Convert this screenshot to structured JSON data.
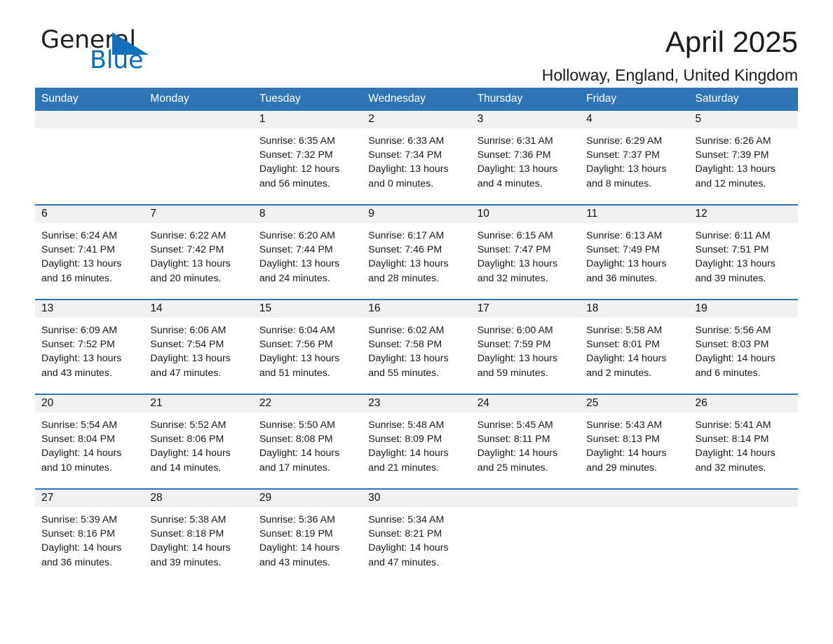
{
  "brand": {
    "line1": "General",
    "line2": "Blue",
    "flag_icon": "triangle-flag-icon",
    "accent_color": "#1170b8"
  },
  "header": {
    "title": "April 2025",
    "subtitle": "Holloway, England, United Kingdom"
  },
  "theme": {
    "header_bg": "#2e75b6",
    "daynum_bg": "#f1f1f1",
    "row_divider": "#2e75b6"
  },
  "weekday_headers": [
    "Sunday",
    "Monday",
    "Tuesday",
    "Wednesday",
    "Thursday",
    "Friday",
    "Saturday"
  ],
  "weeks": [
    [
      {
        "day": "",
        "sunrise": "",
        "sunset": "",
        "daylight_1": "",
        "daylight_2": ""
      },
      {
        "day": "",
        "sunrise": "",
        "sunset": "",
        "daylight_1": "",
        "daylight_2": ""
      },
      {
        "day": "1",
        "sunrise": "Sunrise: 6:35 AM",
        "sunset": "Sunset: 7:32 PM",
        "daylight_1": "Daylight: 12 hours",
        "daylight_2": "and 56 minutes."
      },
      {
        "day": "2",
        "sunrise": "Sunrise: 6:33 AM",
        "sunset": "Sunset: 7:34 PM",
        "daylight_1": "Daylight: 13 hours",
        "daylight_2": "and 0 minutes."
      },
      {
        "day": "3",
        "sunrise": "Sunrise: 6:31 AM",
        "sunset": "Sunset: 7:36 PM",
        "daylight_1": "Daylight: 13 hours",
        "daylight_2": "and 4 minutes."
      },
      {
        "day": "4",
        "sunrise": "Sunrise: 6:29 AM",
        "sunset": "Sunset: 7:37 PM",
        "daylight_1": "Daylight: 13 hours",
        "daylight_2": "and 8 minutes."
      },
      {
        "day": "5",
        "sunrise": "Sunrise: 6:26 AM",
        "sunset": "Sunset: 7:39 PM",
        "daylight_1": "Daylight: 13 hours",
        "daylight_2": "and 12 minutes."
      }
    ],
    [
      {
        "day": "6",
        "sunrise": "Sunrise: 6:24 AM",
        "sunset": "Sunset: 7:41 PM",
        "daylight_1": "Daylight: 13 hours",
        "daylight_2": "and 16 minutes."
      },
      {
        "day": "7",
        "sunrise": "Sunrise: 6:22 AM",
        "sunset": "Sunset: 7:42 PM",
        "daylight_1": "Daylight: 13 hours",
        "daylight_2": "and 20 minutes."
      },
      {
        "day": "8",
        "sunrise": "Sunrise: 6:20 AM",
        "sunset": "Sunset: 7:44 PM",
        "daylight_1": "Daylight: 13 hours",
        "daylight_2": "and 24 minutes."
      },
      {
        "day": "9",
        "sunrise": "Sunrise: 6:17 AM",
        "sunset": "Sunset: 7:46 PM",
        "daylight_1": "Daylight: 13 hours",
        "daylight_2": "and 28 minutes."
      },
      {
        "day": "10",
        "sunrise": "Sunrise: 6:15 AM",
        "sunset": "Sunset: 7:47 PM",
        "daylight_1": "Daylight: 13 hours",
        "daylight_2": "and 32 minutes."
      },
      {
        "day": "11",
        "sunrise": "Sunrise: 6:13 AM",
        "sunset": "Sunset: 7:49 PM",
        "daylight_1": "Daylight: 13 hours",
        "daylight_2": "and 36 minutes."
      },
      {
        "day": "12",
        "sunrise": "Sunrise: 6:11 AM",
        "sunset": "Sunset: 7:51 PM",
        "daylight_1": "Daylight: 13 hours",
        "daylight_2": "and 39 minutes."
      }
    ],
    [
      {
        "day": "13",
        "sunrise": "Sunrise: 6:09 AM",
        "sunset": "Sunset: 7:52 PM",
        "daylight_1": "Daylight: 13 hours",
        "daylight_2": "and 43 minutes."
      },
      {
        "day": "14",
        "sunrise": "Sunrise: 6:06 AM",
        "sunset": "Sunset: 7:54 PM",
        "daylight_1": "Daylight: 13 hours",
        "daylight_2": "and 47 minutes."
      },
      {
        "day": "15",
        "sunrise": "Sunrise: 6:04 AM",
        "sunset": "Sunset: 7:56 PM",
        "daylight_1": "Daylight: 13 hours",
        "daylight_2": "and 51 minutes."
      },
      {
        "day": "16",
        "sunrise": "Sunrise: 6:02 AM",
        "sunset": "Sunset: 7:58 PM",
        "daylight_1": "Daylight: 13 hours",
        "daylight_2": "and 55 minutes."
      },
      {
        "day": "17",
        "sunrise": "Sunrise: 6:00 AM",
        "sunset": "Sunset: 7:59 PM",
        "daylight_1": "Daylight: 13 hours",
        "daylight_2": "and 59 minutes."
      },
      {
        "day": "18",
        "sunrise": "Sunrise: 5:58 AM",
        "sunset": "Sunset: 8:01 PM",
        "daylight_1": "Daylight: 14 hours",
        "daylight_2": "and 2 minutes."
      },
      {
        "day": "19",
        "sunrise": "Sunrise: 5:56 AM",
        "sunset": "Sunset: 8:03 PM",
        "daylight_1": "Daylight: 14 hours",
        "daylight_2": "and 6 minutes."
      }
    ],
    [
      {
        "day": "20",
        "sunrise": "Sunrise: 5:54 AM",
        "sunset": "Sunset: 8:04 PM",
        "daylight_1": "Daylight: 14 hours",
        "daylight_2": "and 10 minutes."
      },
      {
        "day": "21",
        "sunrise": "Sunrise: 5:52 AM",
        "sunset": "Sunset: 8:06 PM",
        "daylight_1": "Daylight: 14 hours",
        "daylight_2": "and 14 minutes."
      },
      {
        "day": "22",
        "sunrise": "Sunrise: 5:50 AM",
        "sunset": "Sunset: 8:08 PM",
        "daylight_1": "Daylight: 14 hours",
        "daylight_2": "and 17 minutes."
      },
      {
        "day": "23",
        "sunrise": "Sunrise: 5:48 AM",
        "sunset": "Sunset: 8:09 PM",
        "daylight_1": "Daylight: 14 hours",
        "daylight_2": "and 21 minutes."
      },
      {
        "day": "24",
        "sunrise": "Sunrise: 5:45 AM",
        "sunset": "Sunset: 8:11 PM",
        "daylight_1": "Daylight: 14 hours",
        "daylight_2": "and 25 minutes."
      },
      {
        "day": "25",
        "sunrise": "Sunrise: 5:43 AM",
        "sunset": "Sunset: 8:13 PM",
        "daylight_1": "Daylight: 14 hours",
        "daylight_2": "and 29 minutes."
      },
      {
        "day": "26",
        "sunrise": "Sunrise: 5:41 AM",
        "sunset": "Sunset: 8:14 PM",
        "daylight_1": "Daylight: 14 hours",
        "daylight_2": "and 32 minutes."
      }
    ],
    [
      {
        "day": "27",
        "sunrise": "Sunrise: 5:39 AM",
        "sunset": "Sunset: 8:16 PM",
        "daylight_1": "Daylight: 14 hours",
        "daylight_2": "and 36 minutes."
      },
      {
        "day": "28",
        "sunrise": "Sunrise: 5:38 AM",
        "sunset": "Sunset: 8:18 PM",
        "daylight_1": "Daylight: 14 hours",
        "daylight_2": "and 39 minutes."
      },
      {
        "day": "29",
        "sunrise": "Sunrise: 5:36 AM",
        "sunset": "Sunset: 8:19 PM",
        "daylight_1": "Daylight: 14 hours",
        "daylight_2": "and 43 minutes."
      },
      {
        "day": "30",
        "sunrise": "Sunrise: 5:34 AM",
        "sunset": "Sunset: 8:21 PM",
        "daylight_1": "Daylight: 14 hours",
        "daylight_2": "and 47 minutes."
      },
      {
        "day": "",
        "sunrise": "",
        "sunset": "",
        "daylight_1": "",
        "daylight_2": ""
      },
      {
        "day": "",
        "sunrise": "",
        "sunset": "",
        "daylight_1": "",
        "daylight_2": ""
      },
      {
        "day": "",
        "sunrise": "",
        "sunset": "",
        "daylight_1": "",
        "daylight_2": ""
      }
    ]
  ]
}
